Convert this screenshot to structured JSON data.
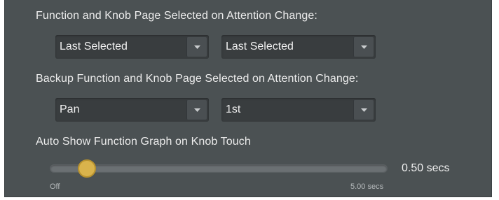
{
  "section1": {
    "heading": "Function and Knob Page Selected on Attention Change:",
    "select_left": {
      "value": "Last Selected"
    },
    "select_right": {
      "value": "Last Selected"
    }
  },
  "section2": {
    "heading": "Backup Function and Knob Page Selected on Attention Change:",
    "select_left": {
      "value": "Pan"
    },
    "select_right": {
      "value": "1st"
    }
  },
  "section3": {
    "heading": "Auto Show Function Graph on Knob Touch",
    "slider": {
      "value_text": "0.50 secs",
      "position_fraction": 0.1,
      "min_label": "Off",
      "max_label": "5.00 secs"
    }
  },
  "icons": {
    "dropdown": "chevron-down-icon"
  },
  "colors": {
    "panel_bg": "#4b5153",
    "select_bg": "#393d3f",
    "thumb": "#d9b34c",
    "text": "#ececec"
  }
}
